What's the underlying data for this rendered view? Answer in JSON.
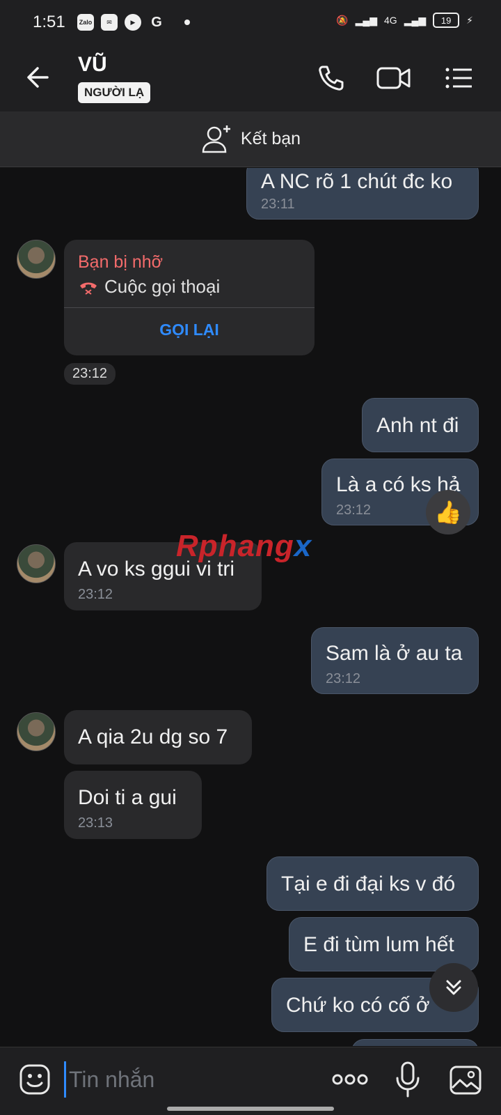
{
  "status_bar": {
    "time": "1:51",
    "app_icons": [
      "zalo-icon",
      "messenger-icon",
      "youtube-icon",
      "google-icon"
    ],
    "zalo_label": "Zalo",
    "network": "4G",
    "battery": "19"
  },
  "header": {
    "title": "VŨ",
    "tag": "NGƯỜI LẠ",
    "icons": [
      "back-arrow-icon",
      "phone-icon",
      "video-call-icon",
      "menu-list-icon"
    ]
  },
  "friend_bar": {
    "label": "Kết bạn"
  },
  "messages": [
    {
      "id": "m1",
      "dir": "out",
      "text": "A NC rõ 1 chút đc ko",
      "time": "23:11"
    },
    {
      "id": "m2",
      "dir": "in",
      "type": "missed_call",
      "title": "Bạn bị nhỡ",
      "sub": "Cuộc gọi thoại",
      "action": "GỌI LẠI",
      "time": "23:12"
    },
    {
      "id": "m3",
      "dir": "out",
      "text": "Anh nt đi"
    },
    {
      "id": "m4",
      "dir": "out",
      "text": "Là a có ks hả",
      "time": "23:12",
      "reaction": "👍"
    },
    {
      "id": "m5",
      "dir": "in",
      "text": "A vo ks ggui vi tri",
      "time": "23:12"
    },
    {
      "id": "m6",
      "dir": "out",
      "text": "Sam là ở au ta",
      "time": "23:12"
    },
    {
      "id": "m7",
      "dir": "in",
      "text": "A qia 2u dg so 7"
    },
    {
      "id": "m8",
      "dir": "in",
      "text": "Doi ti a gui",
      "time": "23:13"
    },
    {
      "id": "m9",
      "dir": "out",
      "text": "Tại e đi đại ks v đó"
    },
    {
      "id": "m10",
      "dir": "out",
      "text": "E đi tùm lum hết"
    },
    {
      "id": "m11",
      "dir": "out",
      "text": "Chứ ko có cố ở"
    }
  ],
  "watermark": {
    "part1": "Rphang",
    "part2": "x"
  },
  "input_bar": {
    "placeholder": "Tin nhắn",
    "value": ""
  },
  "colors": {
    "outgoing_bubble": "#364253",
    "incoming_bubble": "#29292b",
    "missed_call_red": "#f36b6b",
    "link_blue": "#2f8bff",
    "background": "#111112"
  }
}
